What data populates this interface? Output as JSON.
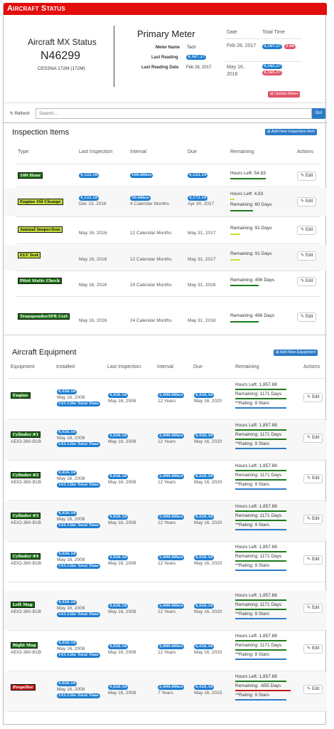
{
  "window_title": "Aircraft Status",
  "status": {
    "heading": "Aircraft MX Status",
    "tail_number": "N46299",
    "model": "CESSNA 172M (172M)"
  },
  "meter": {
    "heading": "Primary Meter",
    "name_label": "Meter Name",
    "name_value": "Tach",
    "last_reading_label": "Last Reading",
    "last_reading_value": "4,167.27",
    "last_date_label": "Last Reading Date",
    "last_date_value": "Feb 28, 2017",
    "col_date": "Date",
    "col_total": "Total Time",
    "history": [
      {
        "date": "Feb 28, 2017",
        "total": "4,167.27",
        "delta": "2.00"
      },
      {
        "date": "May 16, 2016",
        "total": "4,165.27",
        "delta": "4,165.27"
      }
    ],
    "update_label": "Update Meter"
  },
  "toolbar": {
    "refresh_label": "Refresh",
    "search_placeholder": "Search...",
    "go_label": "Go!"
  },
  "inspection": {
    "title": "Inspection Items",
    "add_label": "Add New Inspection Item",
    "headers": [
      "Type",
      "Last Inspection",
      "Interval",
      "Due",
      "Remaining",
      "Actions"
    ],
    "rows": [
      {
        "type": "100 Hour",
        "color": "g",
        "last_badge": "4,122.10",
        "last_date": "",
        "interval_badge": "100.00hrs",
        "interval_text": "",
        "due_badge": "4,222.10",
        "due_date": "",
        "rem1": "Hours Left: 54.83",
        "rem2": "",
        "edit": "Edit"
      },
      {
        "type": "Engine Oil Change",
        "color": "y",
        "last_badge": "4,122.10",
        "last_date": "Dec 23, 2016",
        "interval_badge": "50.00hrs",
        "interval_text": "4 Calendar Months",
        "due_badge": "4,172.10",
        "due_date": "Apr 30, 2017",
        "rem1": "Hours Left: 4.83",
        "rem2": "Remaining: 60 Days",
        "edit": "Edit"
      },
      {
        "type": "Annual Inspection",
        "color": "y",
        "last_badge": "",
        "last_date": "May 16, 2016",
        "interval_badge": "",
        "interval_text": "12 Calendar Months",
        "due_badge": "",
        "due_date": "May 31, 2017",
        "rem1": "Remaining: 91 Days",
        "rem2": "",
        "edit": "Edit"
      },
      {
        "type": "ELT Test",
        "color": "y",
        "last_badge": "",
        "last_date": "May 16, 2016",
        "interval_badge": "",
        "interval_text": "12 Calendar Months",
        "due_badge": "",
        "due_date": "May 31, 2017",
        "rem1": "Remaining: 91 Days",
        "rem2": "",
        "edit": "Edit"
      },
      {
        "type": "Pitot Static Check",
        "color": "g",
        "last_badge": "",
        "last_date": "May 16, 2016",
        "interval_badge": "",
        "interval_text": "24 Calendar Months",
        "due_badge": "",
        "due_date": "May 31, 2018",
        "rem1": "Remaining: 456 Days",
        "rem2": "",
        "edit": "Edit"
      },
      {
        "type": "Transponder/IFR Cert",
        "color": "g",
        "last_badge": "",
        "last_date": "May 16, 2016",
        "interval_badge": "",
        "interval_text": "24 Calendar Months",
        "due_badge": "",
        "due_date": "May 31, 2018",
        "rem1": "Remaining: 456 Days",
        "rem2": "",
        "edit": "Edit"
      }
    ]
  },
  "equipment": {
    "title": "Aircraft Equipment",
    "add_label": "Add New Equipment",
    "headers": [
      "Equipment",
      "Installed",
      "Last Inspection",
      "Interval",
      "Due",
      "Remaining",
      "Actions"
    ],
    "rows": [
      {
        "name": "Engine",
        "color": "g",
        "model": "",
        "inst_badge": "4,026.18",
        "inst_date": "May 16, 2008",
        "total_badge": "143.12hr Total Time",
        "last_badge": "4,026.18",
        "last_date": "May 16, 2008",
        "int_badge": "2,000.00hrs",
        "int_text": "12 Years",
        "due_badge": "6,026.18",
        "due_date": "May 16, 2020",
        "hours": "Hours Left: 1,857.88",
        "days": "Remaining: 1171 Days",
        "rating": "**Rating: 9 Stars",
        "edit": "Edit"
      },
      {
        "name": "Cylinder #1",
        "color": "g",
        "model": "AEIO-360-B1B",
        "inst_badge": "4,026.18",
        "inst_date": "May 16, 2008",
        "total_badge": "143.12hr Total Time",
        "last_badge": "4,026.18",
        "last_date": "May 16, 2008",
        "int_badge": "2,000.00hrs",
        "int_text": "12 Years",
        "due_badge": "6,026.18",
        "due_date": "May 16, 2020",
        "hours": "Hours Left: 1,857.88",
        "days": "Remaining: 1171 Days",
        "rating": "**Rating: 9 Stars",
        "edit": "Edit"
      },
      {
        "name": "Cylinder #2",
        "color": "g",
        "model": "AEIO-360-B1B",
        "inst_badge": "4,026.18",
        "inst_date": "May 16, 2008",
        "total_badge": "143.12hr Total Time",
        "last_badge": "4,026.18",
        "last_date": "May 16, 2008",
        "int_badge": "2,000.00hrs",
        "int_text": "12 Years",
        "due_badge": "6,026.18",
        "due_date": "May 16, 2020",
        "hours": "Hours Left: 1,857.88",
        "days": "Remaining: 1171 Days",
        "rating": "**Rating: 9 Stars",
        "edit": "Edit"
      },
      {
        "name": "Cylinder #3",
        "color": "g",
        "model": "AEIO-360-B1B",
        "inst_badge": "4,026.18",
        "inst_date": "May 16, 2008",
        "total_badge": "143.12hr Total Time",
        "last_badge": "4,026.18",
        "last_date": "May 16, 2008",
        "int_badge": "2,000.00hrs",
        "int_text": "12 Years",
        "due_badge": "6,026.18",
        "due_date": "May 16, 2020",
        "hours": "Hours Left: 1,857.88",
        "days": "Remaining: 1171 Days",
        "rating": "**Rating: 9 Stars",
        "edit": "Edit"
      },
      {
        "name": "Cylinder #4",
        "color": "g",
        "model": "AEIO-360-B1B",
        "inst_badge": "4,026.18",
        "inst_date": "May 16, 2008",
        "total_badge": "143.12hr Total Time",
        "last_badge": "4,026.18",
        "last_date": "May 16, 2008",
        "int_badge": "2,000.00hrs",
        "int_text": "12 Years",
        "due_badge": "6,026.18",
        "due_date": "May 16, 2020",
        "hours": "Hours Left: 1,857.88",
        "days": "Remaining: 1171 Days",
        "rating": "**Rating: 9 Stars",
        "edit": "Edit"
      },
      {
        "name": "Left Mag",
        "color": "g",
        "model": "AEIO-360-B1B",
        "inst_badge": "4,026.18",
        "inst_date": "May 16, 2008",
        "total_badge": "143.12hr Total Time",
        "last_badge": "4,026.18",
        "last_date": "May 16, 2008",
        "int_badge": "2,000.00hrs",
        "int_text": "12 Years",
        "due_badge": "6,026.18",
        "due_date": "May 16, 2020",
        "hours": "Hours Left: 1,857.88",
        "days": "Remaining: 1171 Days",
        "rating": "**Rating: 9 Stars",
        "edit": "Edit"
      },
      {
        "name": "Right Mag",
        "color": "g",
        "model": "AEIO-360-B1B",
        "inst_badge": "4,026.18",
        "inst_date": "May 16, 2008",
        "total_badge": "143.12hr Total Time",
        "last_badge": "4,026.18",
        "last_date": "May 16, 2008",
        "int_badge": "2,000.00hrs",
        "int_text": "12 Years",
        "due_badge": "6,026.18",
        "due_date": "May 16, 2020",
        "hours": "Hours Left: 1,857.88",
        "days": "Remaining: 1171 Days",
        "rating": "**Rating: 9 Stars",
        "edit": "Edit"
      },
      {
        "name": "Propeller",
        "color": "r",
        "model": "",
        "inst_badge": "4,026.18",
        "inst_date": "May 16, 2008",
        "total_badge": "143.12hr Total Time",
        "last_badge": "4,026.18",
        "last_date": "May 16, 2008",
        "int_badge": "2,000.00hrs",
        "int_text": "7 Years",
        "due_badge": "6,026.18",
        "due_date": "May 16, 2015",
        "hours": "Hours Left: 1,857.88",
        "days": "Remaining: -655 Days",
        "rating": "**Rating: 9 Stars",
        "edit": "Edit"
      }
    ]
  },
  "colors": {
    "title_bar": "#e30d0d",
    "badge": "#1e7dd0",
    "good": "#1b7a1b",
    "warn": "#c9df3d",
    "overdue": "#c21717"
  }
}
